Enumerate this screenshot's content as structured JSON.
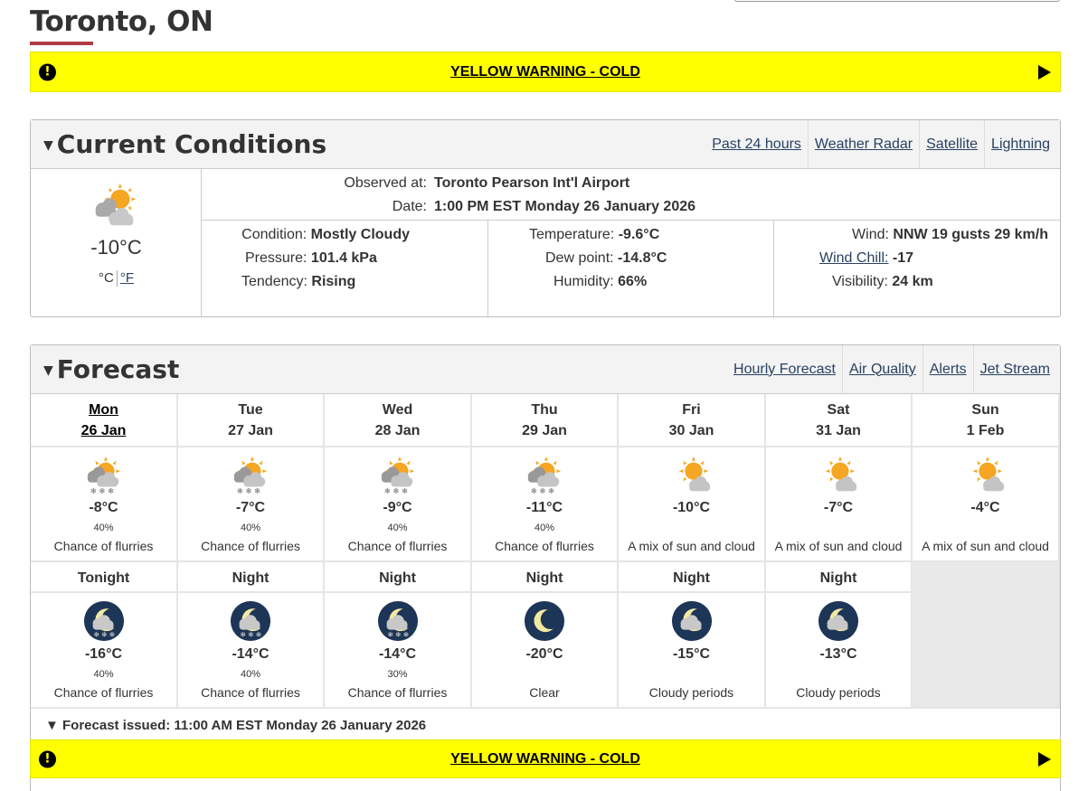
{
  "page": {
    "city": "Toronto, ON",
    "warning_text": "YELLOW WARNING - COLD",
    "warning_icon": "exclamation-icon"
  },
  "current": {
    "title": "Current Conditions",
    "links": [
      "Past 24 hours",
      "Weather Radar",
      "Satellite",
      "Lightning"
    ],
    "icon": "sun-cloud-icon",
    "temp": "-10°C",
    "unit_c": "°C",
    "unit_f": "°F",
    "observed_label": "Observed at:",
    "observed_value": "Toronto Pearson Int'l Airport",
    "date_label": "Date:",
    "date_value": "1:00 PM EST Monday 26 January 2026",
    "col1": [
      {
        "label": "Condition:",
        "value": "Mostly Cloudy"
      },
      {
        "label": "Pressure:",
        "value": "101.4 kPa"
      },
      {
        "label": "Tendency:",
        "value": "Rising"
      }
    ],
    "col2": [
      {
        "label": "Temperature:",
        "value": "-9.6°C"
      },
      {
        "label": "Dew point:",
        "value": "-14.8°C"
      },
      {
        "label": "Humidity:",
        "value": "66%"
      }
    ],
    "col3": [
      {
        "label": "Wind:",
        "value": "NNW 19 gusts 29 km/h"
      },
      {
        "label": "Wind Chill:",
        "value": "-17"
      },
      {
        "label": "Visibility:",
        "value": "24 km"
      }
    ]
  },
  "forecast": {
    "title": "Forecast",
    "links": [
      "Hourly Forecast",
      "Air Quality",
      "Alerts",
      "Jet Stream"
    ],
    "days": [
      {
        "day": "Mon",
        "date": "26 Jan",
        "active": true,
        "icon": "sun-cloud-snow-icon",
        "temp": "-8°C",
        "pop": "40%",
        "desc": "Chance of flurries"
      },
      {
        "day": "Tue",
        "date": "27 Jan",
        "active": false,
        "icon": "sun-cloud-snow-icon",
        "temp": "-7°C",
        "pop": "40%",
        "desc": "Chance of flurries"
      },
      {
        "day": "Wed",
        "date": "28 Jan",
        "active": false,
        "icon": "sun-cloud-snow-icon",
        "temp": "-9°C",
        "pop": "40%",
        "desc": "Chance of flurries"
      },
      {
        "day": "Thu",
        "date": "29 Jan",
        "active": false,
        "icon": "sun-cloud-snow-icon",
        "temp": "-11°C",
        "pop": "40%",
        "desc": "Chance of flurries"
      },
      {
        "day": "Fri",
        "date": "30 Jan",
        "active": false,
        "icon": "sun-cloud-icon",
        "temp": "-10°C",
        "pop": "",
        "desc": "A mix of sun and cloud"
      },
      {
        "day": "Sat",
        "date": "31 Jan",
        "active": false,
        "icon": "sun-cloud-icon",
        "temp": "-7°C",
        "pop": "",
        "desc": "A mix of sun and cloud"
      },
      {
        "day": "Sun",
        "date": "1 Feb",
        "active": false,
        "icon": "sun-cloud-icon",
        "temp": "-4°C",
        "pop": "",
        "desc": "A mix of sun and cloud"
      }
    ],
    "nights": [
      {
        "label": "Tonight",
        "icon": "moon-cloud-snow-icon",
        "temp": "-16°C",
        "pop": "40%",
        "desc": "Chance of flurries"
      },
      {
        "label": "Night",
        "icon": "moon-cloud-snow-icon",
        "temp": "-14°C",
        "pop": "40%",
        "desc": "Chance of flurries"
      },
      {
        "label": "Night",
        "icon": "moon-cloud-snow-icon",
        "temp": "-14°C",
        "pop": "30%",
        "desc": "Chance of flurries"
      },
      {
        "label": "Night",
        "icon": "moon-clear-icon",
        "temp": "-20°C",
        "pop": "",
        "desc": "Clear"
      },
      {
        "label": "Night",
        "icon": "moon-cloud-icon",
        "temp": "-15°C",
        "pop": "",
        "desc": "Cloudy periods"
      },
      {
        "label": "Night",
        "icon": "moon-cloud-icon",
        "temp": "-13°C",
        "pop": "",
        "desc": "Cloudy periods"
      }
    ],
    "issued": "Forecast issued: 11:00 AM EST Monday 26 January 2026"
  },
  "colors": {
    "warning": "#ffff00",
    "title_accent": "#af3c43",
    "link": "#284162",
    "sun": "#f5a623",
    "cloud": "#b9b9b9",
    "night": "#1d3557"
  }
}
